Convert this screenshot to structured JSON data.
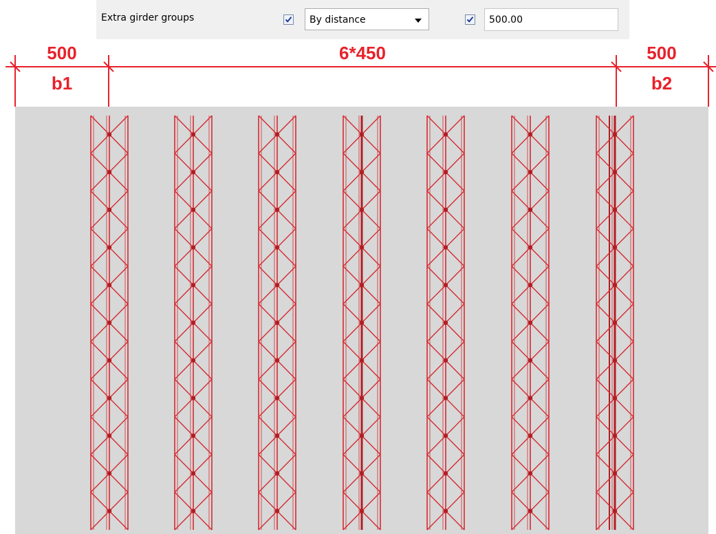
{
  "toolbar": {
    "label": "Extra girder groups",
    "checkbox1_checked": true,
    "method_value": "By distance",
    "checkbox2_checked": true,
    "distance_value": "500.00"
  },
  "dimensions": {
    "left_value": "500",
    "left_label": "b1",
    "middle_value": "6*450",
    "right_value": "500",
    "right_label": "b2"
  },
  "colors": {
    "dimension": "#e8212b",
    "truss": "#d42a30",
    "truss_dark": "#b01e24",
    "background": "#d8d8d8"
  },
  "girders": {
    "count": 7,
    "panels": 11
  }
}
